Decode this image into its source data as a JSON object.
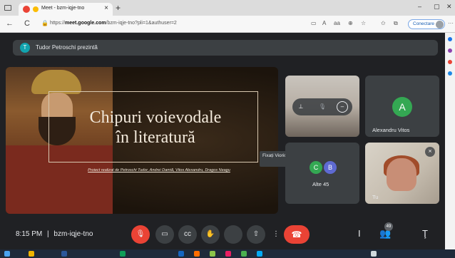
{
  "browser": {
    "tab_title": "Meet - bzm-iqje-tno",
    "tab_close": "×",
    "new_tab": "+",
    "window_controls": [
      "–",
      "▢",
      "✕"
    ],
    "nav_back": "←",
    "nav_reload": "C",
    "url_prefix": "https://",
    "url_domain": "meet.google.com",
    "url_path": "/bzm-iqje-tno?pli=1&authuser=2",
    "sign_in_label": "Conectare",
    "more_icon": "···"
  },
  "meet": {
    "presenter": {
      "avatar_initial": "T",
      "text": "Tudor Petroschi prezintă"
    },
    "slide": {
      "title_line1": "Chipuri voievodale",
      "title_line2": "în literatură",
      "subtitle": "Proiect realizat de Petroschi Tudor, Andrei Damiă, Vitos Alexandru, Dragos Neagu"
    },
    "tiles": {
      "pin_tooltip": "Fixați Viorica Teut pe ecranul principal",
      "alexandru": {
        "initial": "A",
        "name": "Alexandru Vitos"
      },
      "others": {
        "initial1": "C",
        "initial2": "B",
        "label": "Alte 45"
      },
      "self": {
        "name": "Tu"
      }
    },
    "bottom": {
      "time": "8:15 PM",
      "separator": "|",
      "meeting_code": "bzm-iqje-tno",
      "participant_count": "49"
    }
  },
  "colors": {
    "meet_bg": "#202124",
    "surface": "#3c4043",
    "danger": "#ea4335",
    "accent_green": "#34a853"
  }
}
